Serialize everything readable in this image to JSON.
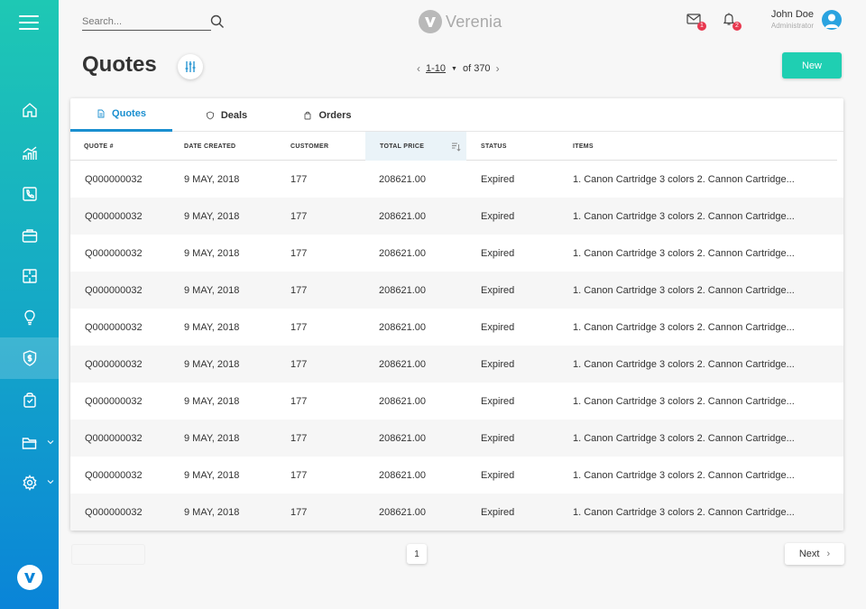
{
  "app": {
    "brand": "Verenia"
  },
  "search": {
    "placeholder": "Search..."
  },
  "header": {
    "messages_badge": "1",
    "notifications_badge": "2",
    "user_name": "John Doe",
    "user_role": "Administrator"
  },
  "sidebar": {
    "items": [
      {
        "icon": "home-icon"
      },
      {
        "icon": "analytics-icon"
      },
      {
        "icon": "phone-book-icon"
      },
      {
        "icon": "briefcase-icon"
      },
      {
        "icon": "puzzle-icon"
      },
      {
        "icon": "lightbulb-icon"
      },
      {
        "icon": "quote-shield-icon",
        "active": true
      },
      {
        "icon": "shopping-bag-icon"
      },
      {
        "icon": "folder-icon",
        "expandable": true
      },
      {
        "icon": "gear-icon",
        "expandable": true
      }
    ]
  },
  "page": {
    "title": "Quotes"
  },
  "pager": {
    "range": "1-10",
    "of_total": "of 370"
  },
  "actions": {
    "new_label": "New"
  },
  "tabs": [
    {
      "label": "Quotes",
      "icon": "document-icon",
      "active": true
    },
    {
      "label": "Deals",
      "icon": "shield-icon"
    },
    {
      "label": "Orders",
      "icon": "bag-icon"
    }
  ],
  "table": {
    "columns": [
      "QUOTE #",
      "DATE CREATED",
      "CUSTOMER",
      "TOTAL PRICE",
      "STATUS",
      "ITEMS"
    ],
    "sorted_column": "TOTAL PRICE",
    "rows": [
      [
        "Q000000032",
        "9 MAY, 2018",
        "177",
        "208621.00",
        "Expired",
        "1. Canon Cartridge 3 colors  2. Cannon Cartridge..."
      ],
      [
        "Q000000032",
        "9 MAY, 2018",
        "177",
        "208621.00",
        "Expired",
        "1. Canon Cartridge 3 colors  2. Cannon Cartridge..."
      ],
      [
        "Q000000032",
        "9 MAY, 2018",
        "177",
        "208621.00",
        "Expired",
        "1. Canon Cartridge 3 colors  2. Cannon Cartridge..."
      ],
      [
        "Q000000032",
        "9 MAY, 2018",
        "177",
        "208621.00",
        "Expired",
        "1. Canon Cartridge 3 colors  2. Cannon Cartridge..."
      ],
      [
        "Q000000032",
        "9 MAY, 2018",
        "177",
        "208621.00",
        "Expired",
        "1. Canon Cartridge 3 colors  2. Cannon Cartridge..."
      ],
      [
        "Q000000032",
        "9 MAY, 2018",
        "177",
        "208621.00",
        "Expired",
        "1. Canon Cartridge 3 colors  2. Cannon Cartridge..."
      ],
      [
        "Q000000032",
        "9 MAY, 2018",
        "177",
        "208621.00",
        "Expired",
        "1. Canon Cartridge 3 colors  2. Cannon Cartridge..."
      ],
      [
        "Q000000032",
        "9 MAY, 2018",
        "177",
        "208621.00",
        "Expired",
        "1. Canon Cartridge 3 colors  2. Cannon Cartridge..."
      ],
      [
        "Q000000032",
        "9 MAY, 2018",
        "177",
        "208621.00",
        "Expired",
        "1. Canon Cartridge 3 colors  2. Cannon Cartridge..."
      ],
      [
        "Q000000032",
        "9 MAY, 2018",
        "177",
        "208621.00",
        "Expired",
        "1. Canon Cartridge 3 colors  2. Cannon Cartridge..."
      ]
    ]
  },
  "pagination": {
    "current_page": "1",
    "next_label": "Next"
  },
  "colors": {
    "accent": "#1fcfb2",
    "tab_active": "#1a8fd0",
    "badge": "#e8384f"
  }
}
